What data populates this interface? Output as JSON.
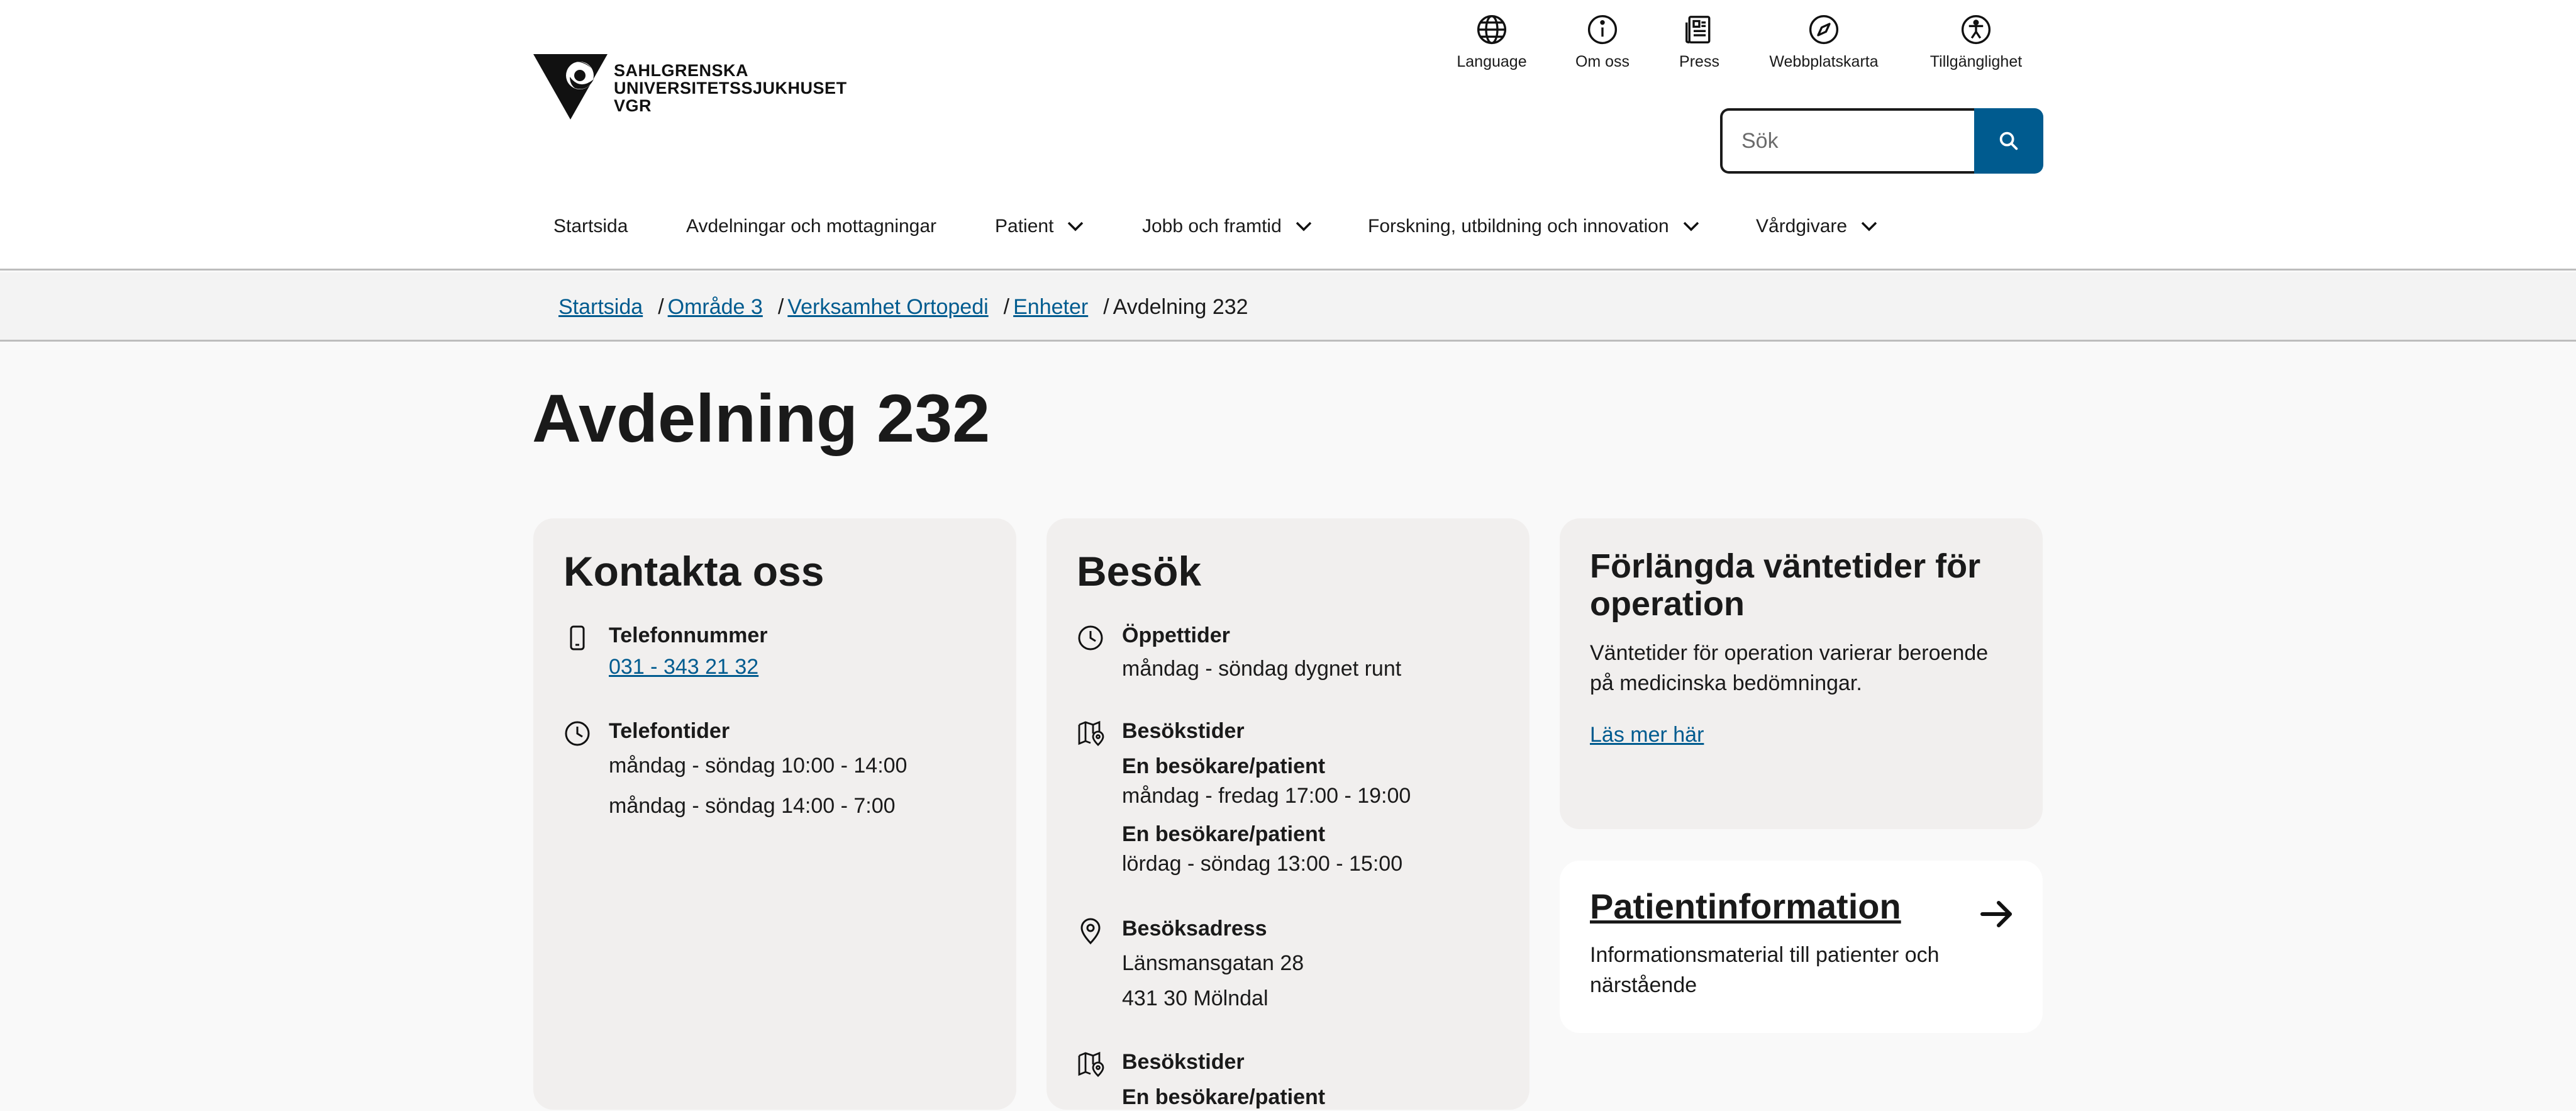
{
  "logo": {
    "line1": "SAHLGRENSKA",
    "line2": "UNIVERSITETSSJUKHUSET",
    "line3": "VGR"
  },
  "utility_nav": [
    {
      "label": "Language",
      "icon": "globe-icon"
    },
    {
      "label": "Om oss",
      "icon": "info-icon"
    },
    {
      "label": "Press",
      "icon": "newspaper-icon"
    },
    {
      "label": "Webbplatskarta",
      "icon": "compass-icon"
    },
    {
      "label": "Tillgänglighet",
      "icon": "accessibility-icon"
    }
  ],
  "search": {
    "placeholder": "Sök",
    "value": ""
  },
  "main_nav": [
    {
      "label": "Startsida",
      "has_dropdown": false
    },
    {
      "label": "Avdelningar och mottagningar",
      "has_dropdown": false
    },
    {
      "label": "Patient",
      "has_dropdown": true
    },
    {
      "label": "Jobb och framtid",
      "has_dropdown": true
    },
    {
      "label": "Forskning, utbildning och innovation",
      "has_dropdown": true
    },
    {
      "label": "Vårdgivare",
      "has_dropdown": true
    }
  ],
  "breadcrumb": [
    {
      "label": "Startsida",
      "link": true
    },
    {
      "label": "Område 3",
      "link": true
    },
    {
      "label": "Verksamhet Ortopedi",
      "link": true
    },
    {
      "label": "Enheter",
      "link": true
    },
    {
      "label": "Avdelning 232",
      "link": false
    }
  ],
  "page_title": "Avdelning 232",
  "contact": {
    "title": "Kontakta oss",
    "phone_label": "Telefonnummer",
    "phone": "031 - 343 21 32",
    "hours_label": "Telefontider",
    "hours": [
      "måndag - söndag 10:00 - 14:00",
      "måndag - söndag 14:00 - 7:00"
    ]
  },
  "visit": {
    "title": "Besök",
    "open_label": "Öppettider",
    "open_value": "måndag - söndag dygnet runt",
    "visiting_label": "Besökstider",
    "visiting_blocks": [
      {
        "who": "En besökare/patient",
        "when": "måndag - fredag 17:00 - 19:00"
      },
      {
        "who": "En besökare/patient",
        "when": "lördag - söndag 13:00 - 15:00"
      }
    ],
    "address_label": "Besöksadress",
    "address_lines": [
      "Länsmansgatan 28",
      "431 30 Mölndal"
    ],
    "visiting2_label": "Besökstider",
    "visiting2_who": "En besökare/patient"
  },
  "wait": {
    "title": "Förlängda väntetider för operation",
    "text": "Väntetider för operation varierar beroende på medicinska bedömningar.",
    "link": "Läs mer här"
  },
  "patientinfo": {
    "title": "Patientinformation",
    "text": "Informationsmaterial till patienter och närstående"
  },
  "colors": {
    "accent": "#005b8f",
    "card_grey": "#f1efee",
    "page_bg": "#f9f9f9"
  }
}
